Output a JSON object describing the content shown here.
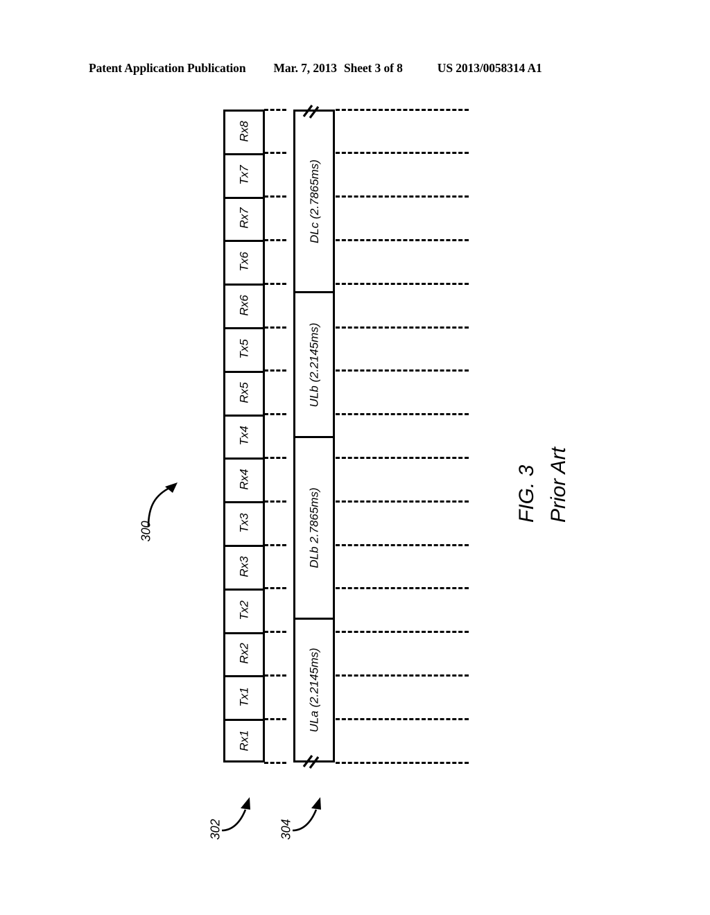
{
  "header": {
    "publication": "Patent Application Publication",
    "date": "Mar. 7, 2013",
    "sheet": "Sheet 3 of 8",
    "patent_number": "US 2013/0058314 A1"
  },
  "figure": {
    "caption_line1": "FIG. 3",
    "caption_line2": "Prior Art",
    "overall_ref": "300",
    "slot_column_ref": "302",
    "burst_column_ref": "304",
    "slots": [
      {
        "label": "Rx8"
      },
      {
        "label": "Tx7"
      },
      {
        "label": "Rx7"
      },
      {
        "label": "Tx6"
      },
      {
        "label": "Rx6"
      },
      {
        "label": "Tx5"
      },
      {
        "label": "Rx5"
      },
      {
        "label": "Tx4"
      },
      {
        "label": "Rx4"
      },
      {
        "label": "Tx3"
      },
      {
        "label": "Rx3"
      },
      {
        "label": "Tx2"
      },
      {
        "label": "Rx2"
      },
      {
        "label": "Tx1"
      },
      {
        "label": "Rx1"
      }
    ],
    "bursts": [
      {
        "label": "DLc (2.7865ms)",
        "duration_ms": 2.7865,
        "direction": "downlink"
      },
      {
        "label": "ULb (2.2145ms)",
        "duration_ms": 2.2145,
        "direction": "uplink"
      },
      {
        "label": "DLb 2.7865ms)",
        "duration_ms": 2.7865,
        "direction": "downlink"
      },
      {
        "label": "ULa (2.2145ms)",
        "duration_ms": 2.2145,
        "direction": "uplink"
      }
    ]
  }
}
